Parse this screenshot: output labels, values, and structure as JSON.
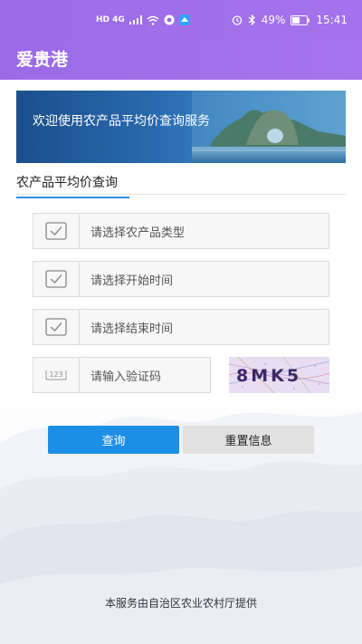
{
  "status_bar": {
    "network_labels": "HD 4G",
    "battery": "49%",
    "time": "15:41"
  },
  "app": {
    "title": "爱贵港"
  },
  "banner": {
    "text": "欢迎使用农产品平均价查询服务"
  },
  "tabs": [
    {
      "label": "农产品平均价查询",
      "active": true
    }
  ],
  "form": {
    "product_type": {
      "placeholder": "请选择农产品类型",
      "icon": "checkbox-icon"
    },
    "start_time": {
      "placeholder": "请选择开始时间",
      "icon": "checkbox-icon"
    },
    "end_time": {
      "placeholder": "请选择结束时间",
      "icon": "checkbox-icon"
    },
    "captcha_input": {
      "placeholder": "请输入验证码",
      "icon_text": "123"
    },
    "captcha_image_text": "8MK5"
  },
  "buttons": {
    "query": "查询",
    "reset": "重置信息"
  },
  "footer": {
    "text": "本服务由自治区农业农村厅提供"
  },
  "colors": {
    "header": "#9b6ae6",
    "primary_button": "#1d8ee6",
    "secondary_button": "#e1e1e1",
    "tab_underline": "#2e8fe0"
  }
}
